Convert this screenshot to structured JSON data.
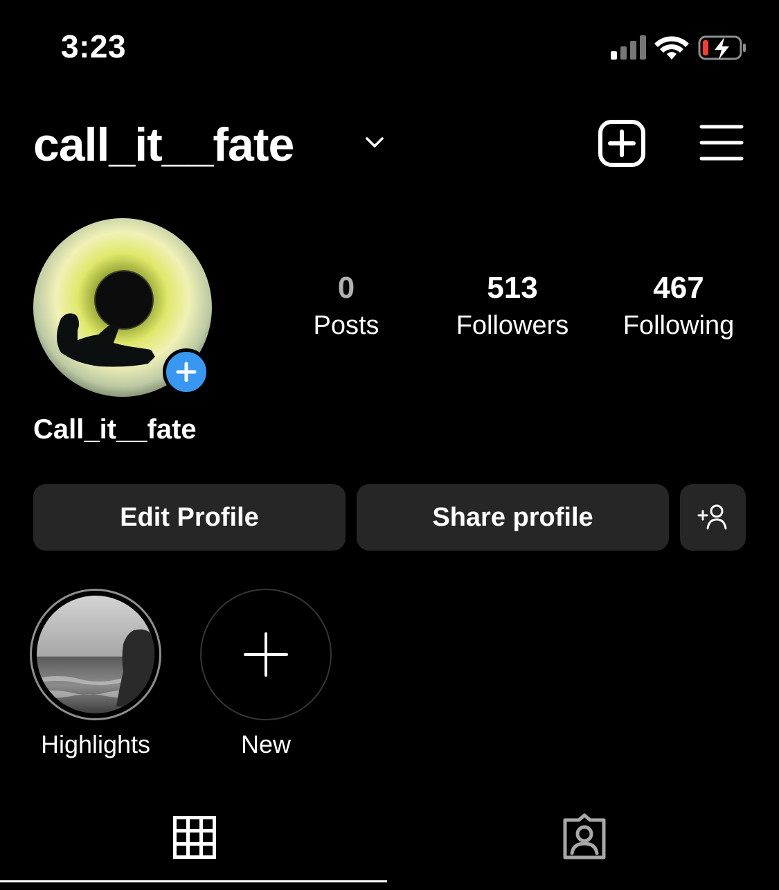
{
  "status_bar": {
    "time": "3:23",
    "icons": [
      "signal-icon",
      "wifi-icon",
      "battery-charging-icon"
    ],
    "battery_level_color": "#ff3b30"
  },
  "header": {
    "username": "call_it__fate",
    "icons": [
      "chevron-down-icon",
      "create-post-icon",
      "hamburger-menu-icon"
    ]
  },
  "profile": {
    "display_name": "Call_it__fate",
    "avatar_add_color": "#3897f0",
    "stats": [
      {
        "count": "0",
        "label": "Posts"
      },
      {
        "count": "513",
        "label": "Followers"
      },
      {
        "count": "467",
        "label": "Following"
      }
    ]
  },
  "actions": {
    "edit_label": "Edit Profile",
    "share_label": "Share profile",
    "discover_icon": "add-person-icon"
  },
  "highlights": [
    {
      "label": "Highlights"
    },
    {
      "label": "New"
    }
  ],
  "tabs": [
    {
      "icon": "grid-icon",
      "active": true
    },
    {
      "icon": "tagged-icon",
      "active": false
    }
  ],
  "colors": {
    "background": "#000000",
    "button_bg": "#262626",
    "text": "#ffffff",
    "muted_count": "#b0b0b0"
  }
}
